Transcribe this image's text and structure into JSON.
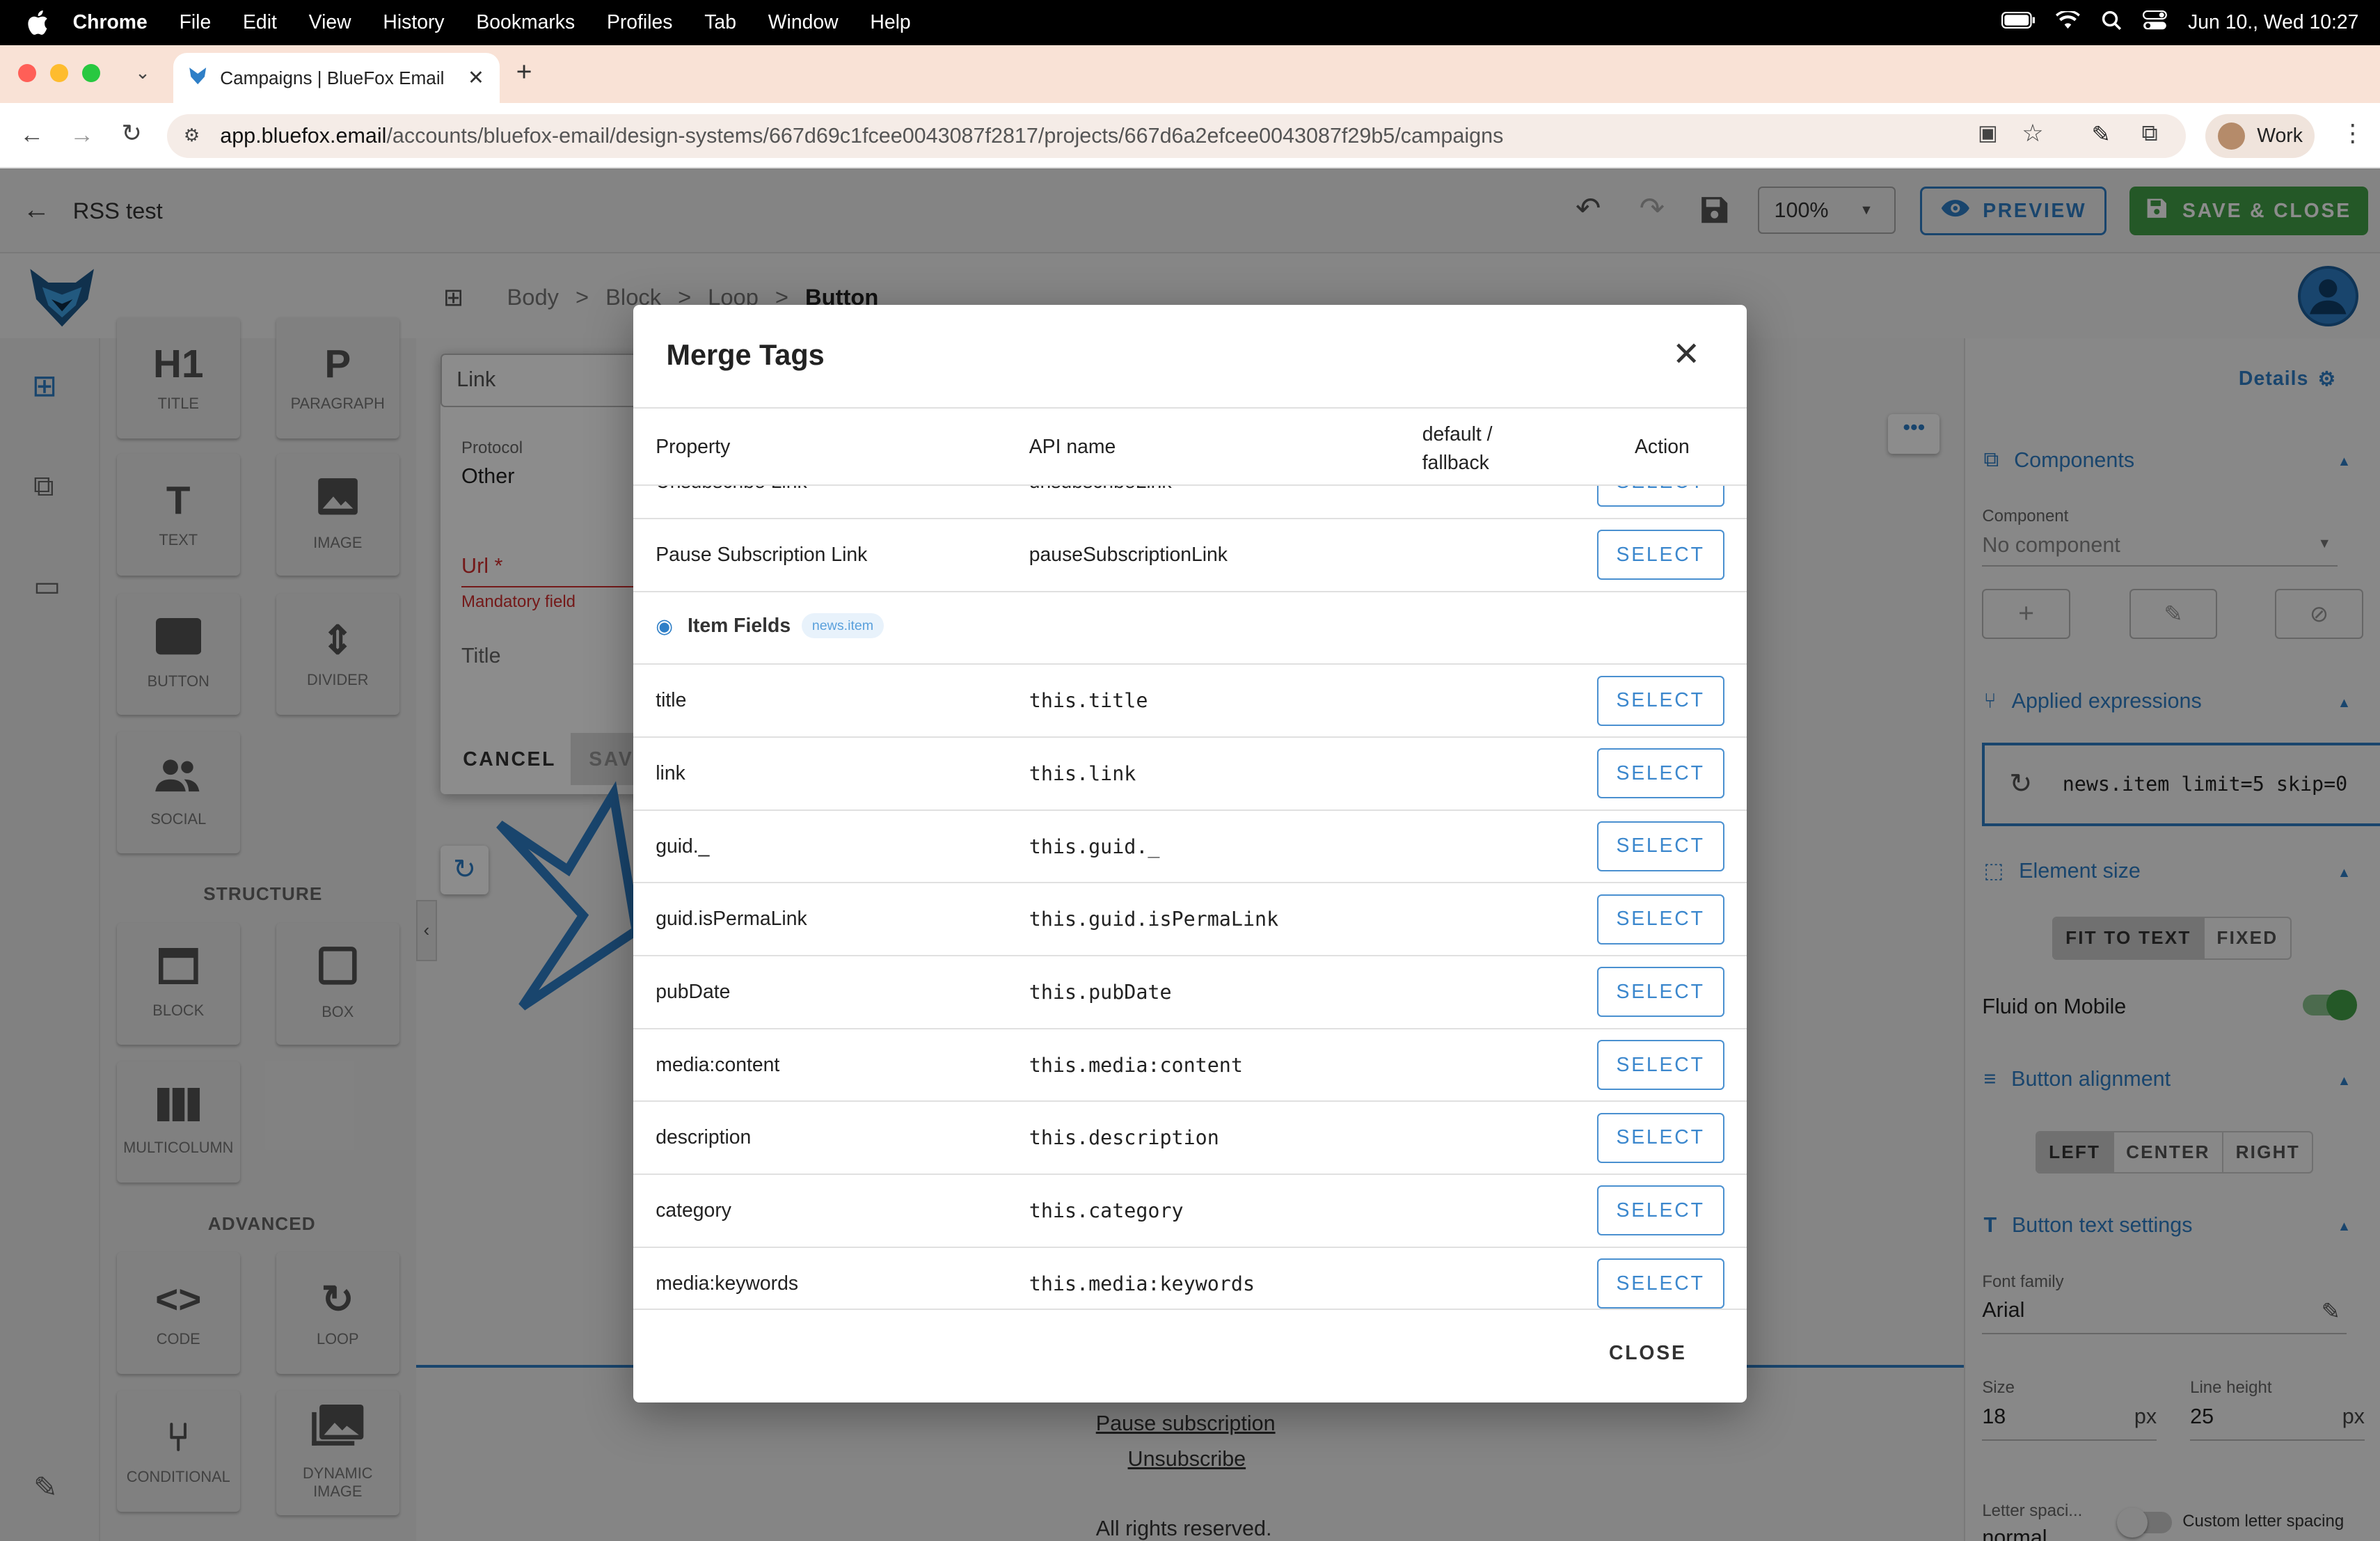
{
  "menubar": {
    "app": "Chrome",
    "items": [
      "File",
      "Edit",
      "View",
      "History",
      "Bookmarks",
      "Profiles",
      "Tab",
      "Window",
      "Help"
    ],
    "datetime": "Jun 10., Wed  10:27"
  },
  "browser": {
    "tab_title": "Campaigns | BlueFox Email",
    "url_host": "app.bluefox.email",
    "url_path": "/accounts/bluefox-email/design-systems/667d69c1fcee0043087f2817/projects/667d6a2efcee0043087f29b5/campaigns",
    "profile": "Work"
  },
  "header": {
    "title": "RSS test",
    "zoom": "100%",
    "preview_label": "PREVIEW",
    "save_close_label": "SAVE & CLOSE"
  },
  "breadcrumb": [
    "Body",
    "Block",
    "Loop",
    "Button"
  ],
  "palette": {
    "basic": [
      {
        "icon": "H1",
        "label": "TITLE"
      },
      {
        "icon": "P",
        "label": "PARAGRAPH"
      },
      {
        "icon": "T",
        "label": "TEXT"
      },
      {
        "icon": "image-icon",
        "label": "IMAGE"
      },
      {
        "icon": "button-icon",
        "label": "BUTTON"
      },
      {
        "icon": "divider-icon",
        "label": "DIVIDER"
      },
      {
        "icon": "social-icon",
        "label": "SOCIAL"
      }
    ],
    "structure_heading": "STRUCTURE",
    "structure": [
      {
        "icon": "block-icon",
        "label": "BLOCK"
      },
      {
        "icon": "box-icon",
        "label": "BOX"
      },
      {
        "icon": "multicolumn-icon",
        "label": "MULTICOLUMN"
      }
    ],
    "advanced_heading": "ADVANCED",
    "advanced": [
      {
        "icon": "code-icon",
        "label": "CODE"
      },
      {
        "icon": "loop-icon",
        "label": "LOOP"
      },
      {
        "icon": "conditional-icon",
        "label": "CONDITIONAL"
      },
      {
        "icon": "dynamic-image-icon",
        "label": "DYNAMIC IMAGE"
      }
    ]
  },
  "link_editor": {
    "type_value": "Link",
    "protocol_label": "Protocol",
    "protocol_value": "Other",
    "url_label": "Url *",
    "url_error": "Mandatory field",
    "title_placeholder": "Title",
    "cancel_label": "CANCEL",
    "save_label": "SAVE"
  },
  "canvas_footer": {
    "pause_link": "Pause subscription",
    "unsubscribe_link": "Unsubscribe",
    "rights": "All rights reserved."
  },
  "right_panel": {
    "details_label": "Details",
    "components_title": "Components",
    "component_label": "Component",
    "component_value": "No component",
    "applied_expressions_title": "Applied expressions",
    "expression": "news.item limit=5 skip=0",
    "element_size_title": "Element size",
    "size_options": [
      "FIT TO TEXT",
      "FIXED"
    ],
    "fluid_mobile_label": "Fluid on Mobile",
    "button_alignment_title": "Button alignment",
    "alignment_options": [
      "LEFT",
      "CENTER",
      "RIGHT"
    ],
    "button_text_title": "Button text settings",
    "font_family_label": "Font family",
    "font_family_value": "Arial",
    "size_label": "Size",
    "size_value": "18",
    "line_height_label": "Line height",
    "line_height_value": "25",
    "unit": "px",
    "letter_spacing_label": "Letter spaci...",
    "letter_spacing_value": "normal",
    "custom_letter_spacing_label": "Custom letter spacing"
  },
  "modal": {
    "title": "Merge Tags",
    "columns": [
      "Property",
      "API name",
      "default / fallback",
      "Action"
    ],
    "partial_row": {
      "property": "Unsubscribe Link",
      "api": "unsubscribeLink"
    },
    "rows_top": [
      {
        "property": "Pause Subscription Link",
        "api": "pauseSubscriptionLink"
      }
    ],
    "group_title": "Item Fields",
    "group_badge": "news.item",
    "rows": [
      {
        "property": "title",
        "api": "this.title"
      },
      {
        "property": "link",
        "api": "this.link"
      },
      {
        "property": "guid._",
        "api": "this.guid._"
      },
      {
        "property": "guid.isPermaLink",
        "api": "this.guid.isPermaLink"
      },
      {
        "property": "pubDate",
        "api": "this.pubDate"
      },
      {
        "property": "media:content",
        "api": "this.media:content"
      },
      {
        "property": "description",
        "api": "this.description"
      },
      {
        "property": "category",
        "api": "this.category"
      },
      {
        "property": "media:keywords",
        "api": "this.media:keywords"
      }
    ],
    "select_label": "SELECT",
    "close_label": "CLOSE"
  }
}
